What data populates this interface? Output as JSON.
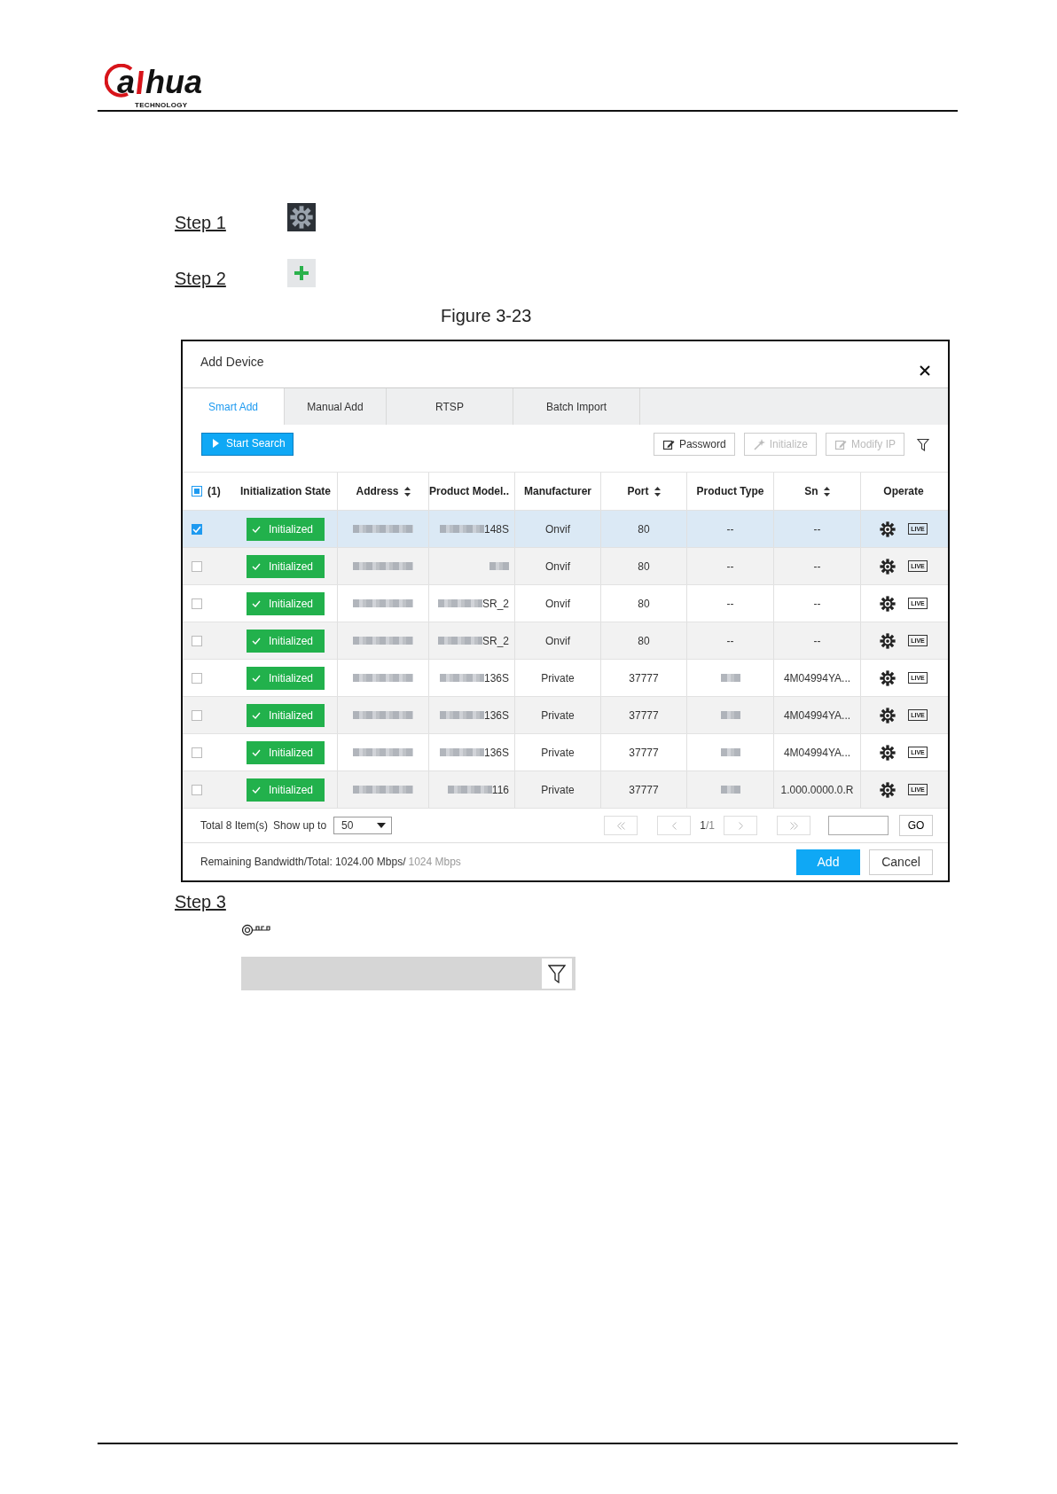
{
  "header": {
    "logo": {
      "mark": "a",
      "name": "hua",
      "tagline": "TECHNOLOGY"
    }
  },
  "steps": [
    {
      "label": "Step 1"
    },
    {
      "label": "Step 2"
    }
  ],
  "figure_caption": "Figure 3-23",
  "dialog": {
    "title": "Add Device",
    "tabs": [
      {
        "label": "Smart Add",
        "selected": true
      },
      {
        "label": "Manual Add",
        "selected": false
      },
      {
        "label": "RTSP",
        "selected": false
      },
      {
        "label": "Batch Import",
        "selected": false
      }
    ],
    "search_button": "Start Search",
    "toolbar": [
      {
        "label": "Password",
        "disabled": false
      },
      {
        "label": "Initialize",
        "disabled": true
      },
      {
        "label": "Modify IP",
        "disabled": true
      }
    ],
    "header_checkbox": {
      "label": "(1)",
      "partial": true
    },
    "columns": [
      {
        "label": "Initialization State",
        "sortable": false
      },
      {
        "label": "Address",
        "sortable": true
      },
      {
        "label": "Product Model..",
        "sortable": false
      },
      {
        "label": "Manufacturer",
        "sortable": false
      },
      {
        "label": "Port",
        "sortable": true
      },
      {
        "label": "Product Type",
        "sortable": false
      },
      {
        "label": "Sn",
        "sortable": true
      },
      {
        "label": "Operate",
        "sortable": false
      }
    ],
    "rows": [
      {
        "selected": true,
        "state": "Initialized",
        "model": "148S",
        "manufacturer": "Onvif",
        "port": "80",
        "product_type": "--",
        "sn": "--",
        "live": "LIVE"
      },
      {
        "selected": false,
        "state": "Initialized",
        "manufacturer": "Onvif",
        "port": "80",
        "product_type": "--",
        "sn": "--",
        "live": "LIVE"
      },
      {
        "selected": false,
        "state": "Initialized",
        "model": "SR_2",
        "manufacturer": "Onvif",
        "port": "80",
        "product_type": "--",
        "sn": "--",
        "live": "LIVE"
      },
      {
        "selected": false,
        "state": "Initialized",
        "model": "SR_2",
        "manufacturer": "Onvif",
        "port": "80",
        "product_type": "--",
        "sn": "--",
        "live": "LIVE"
      },
      {
        "selected": false,
        "state": "Initialized",
        "model": "136S",
        "manufacturer": "Private",
        "port": "37777",
        "sn": "4M04994YA...",
        "live": "LIVE"
      },
      {
        "selected": false,
        "state": "Initialized",
        "model": "136S",
        "manufacturer": "Private",
        "port": "37777",
        "sn": "4M04994YA...",
        "live": "LIVE"
      },
      {
        "selected": false,
        "state": "Initialized",
        "model": "136S",
        "manufacturer": "Private",
        "port": "37777",
        "sn": "4M04994YA...",
        "live": "LIVE"
      },
      {
        "selected": false,
        "state": "Initialized",
        "model": "116",
        "manufacturer": "Private",
        "port": "37777",
        "sn": "1.000.0000.0.R",
        "live": "LIVE"
      }
    ],
    "pager": {
      "total": "Total 8 Item(s)",
      "show_label": "Show up to",
      "page_size": "50",
      "page_current": "1",
      "page_total": "/1",
      "go": "GO"
    },
    "bandwidth": {
      "label": "Remaining Bandwidth/Total: 1024.00 Mbps/",
      "total": "1024 Mbps"
    },
    "buttons": [
      {
        "label": "Add",
        "primary": true
      },
      {
        "label": "Cancel",
        "primary": false
      }
    ]
  },
  "step3": {
    "label": "Step 3"
  }
}
